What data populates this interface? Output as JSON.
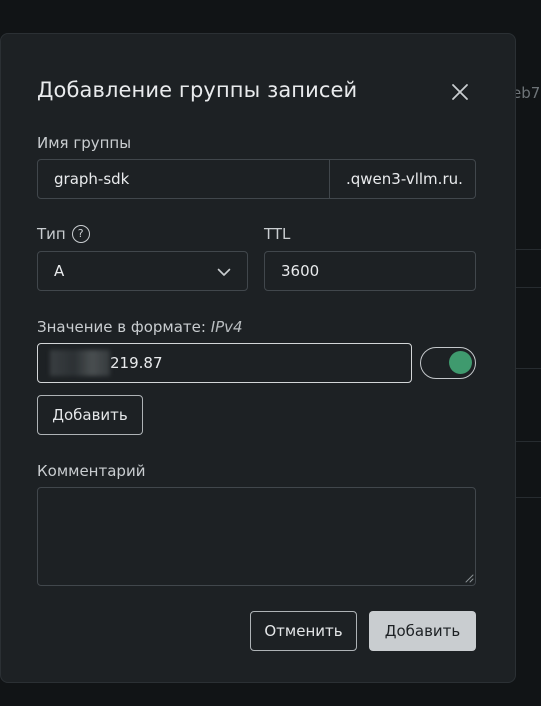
{
  "background": {
    "fragment_text": "eb7"
  },
  "modal": {
    "title": "Добавление группы записей",
    "group_name": {
      "label": "Имя группы",
      "value": "graph-sdk",
      "suffix": ".qwen3-vllm.ru."
    },
    "type": {
      "label": "Тип",
      "help_glyph": "?",
      "value": "A"
    },
    "ttl": {
      "label": "TTL",
      "value": "3600"
    },
    "value_field": {
      "label_prefix": "Значение в формате:",
      "label_format": "IPv4",
      "visible_value": "219.87",
      "toggle_on": true
    },
    "add_value_button": "Добавить",
    "comment": {
      "label": "Комментарий",
      "value": ""
    },
    "cancel_button": "Отменить",
    "submit_button": "Добавить"
  },
  "colors": {
    "accent_toggle": "#3f9a6e",
    "primary_button_bg": "#c9cdd0",
    "modal_bg": "#1d2124"
  },
  "icons": {
    "close": "close-icon",
    "help": "help-circle-icon",
    "dropdown": "chevron-down-icon",
    "resize": "resize-grip-icon"
  }
}
